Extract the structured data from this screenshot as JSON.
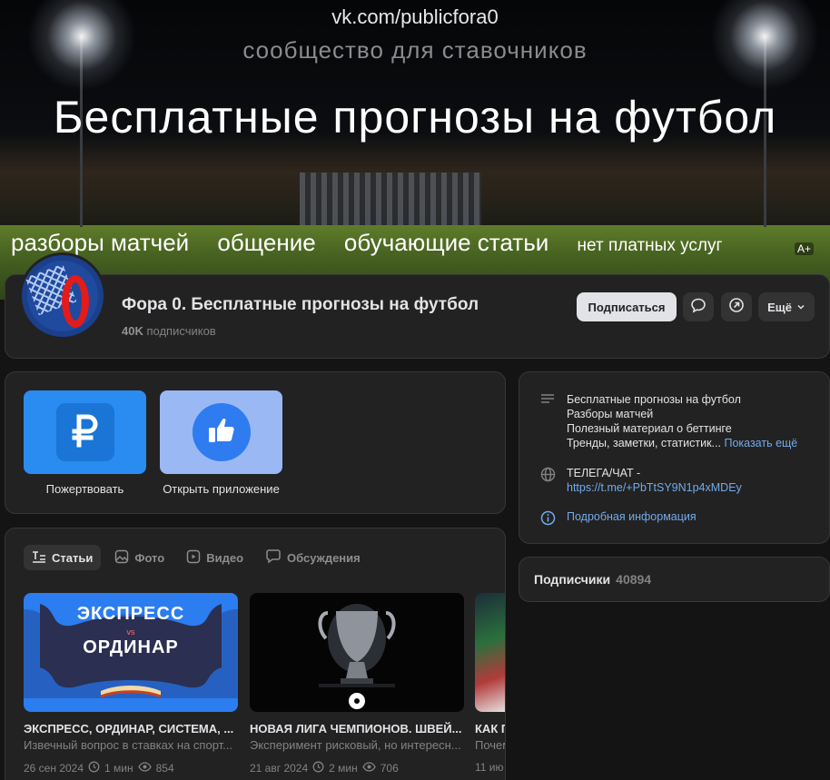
{
  "cover": {
    "url": "vk.com/publicfora0",
    "tagline": "сообщество для ставочников",
    "headline": "Бесплатные прогнозы на футбол",
    "features": [
      "разборы матчей",
      "общение",
      "обучающие статьи",
      "нет платных услуг"
    ],
    "badge": "A+"
  },
  "header": {
    "name": "Фора 0. Бесплатные прогнозы на футбол",
    "subscribers_count": "40K",
    "subscribers_label": "подписчиков",
    "subscribe_label": "Подписаться",
    "message_icon": "chat-bubble-icon",
    "share_icon": "share-arrow-icon",
    "more_label": "Ещё"
  },
  "apps": [
    {
      "label": "Пожертвовать",
      "icon": "ruble-icon"
    },
    {
      "label": "Открыть приложение",
      "icon": "thumbs-up-icon"
    }
  ],
  "tabs": [
    {
      "label": "Статьи",
      "icon": "articles-icon",
      "active": true
    },
    {
      "label": "Фото",
      "icon": "photo-icon",
      "active": false
    },
    {
      "label": "Видео",
      "icon": "video-icon",
      "active": false
    },
    {
      "label": "Обсуждения",
      "icon": "discussions-icon",
      "active": false
    }
  ],
  "posts": [
    {
      "title": "ЭКСПРЕСС, ОРДИНАР, СИСТЕМА, ...",
      "subtitle": "Извечный вопрос в ставках на спорт...",
      "date": "26 сен 2024",
      "read_time": "1 мин",
      "views": "854",
      "cover_title_1": "ЭКСПРЕСС",
      "cover_vs": "vs",
      "cover_title_2": "ОРДИНАР"
    },
    {
      "title": "НОВАЯ ЛИГА ЧЕМПИОНОВ. ШВЕЙ...",
      "subtitle": "Эксперимент рисковый, но интересн...",
      "date": "21 авг 2024",
      "read_time": "2 мин",
      "views": "706"
    },
    {
      "title": "КАК П",
      "subtitle": "Почем",
      "date": "11 ию",
      "read_time": "",
      "views": ""
    }
  ],
  "info": {
    "description_lines": [
      "Бесплатные прогнозы на футбол",
      "Разборы матчей",
      "Полезный материал о беттинге"
    ],
    "description_last": "Тренды, заметки, статистик...",
    "show_more": "Показать ещё",
    "link_label": "ТЕЛЕГА/ЧАТ -",
    "link_url": "https://t.me/+PbTtSY9N1p4xMDEy",
    "details": "Подробная информация"
  },
  "subscribers_block": {
    "label": "Подписчики",
    "count": "40894"
  },
  "colors": {
    "background": "#141414",
    "card": "#222222",
    "accent_link": "#71aaeb",
    "donate_tile": "#2a8cf0",
    "app_tile": "#99b8f4"
  }
}
